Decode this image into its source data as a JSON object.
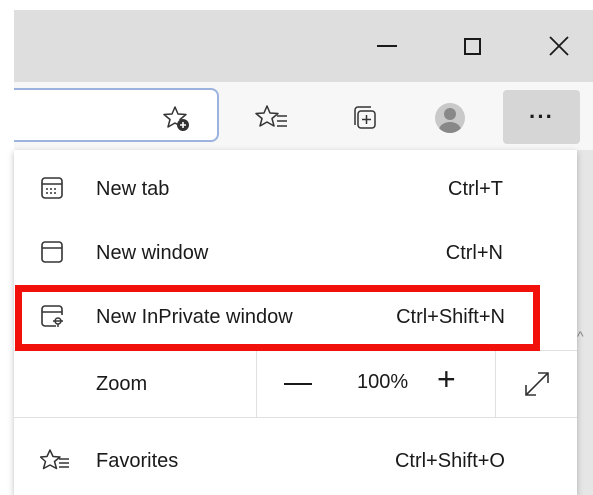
{
  "window": {
    "minimize_icon": "minimize-icon",
    "maximize_icon": "maximize-icon",
    "close_icon": "close-icon"
  },
  "toolbar": {
    "icons": [
      "add-favorite-icon",
      "favorites-icon",
      "collections-icon",
      "profile-avatar",
      "more-icon"
    ],
    "more_label": "···"
  },
  "menu": {
    "items": [
      {
        "label": "New tab",
        "shortcut": "Ctrl+T",
        "icon": "new-tab-icon"
      },
      {
        "label": "New window",
        "shortcut": "Ctrl+N",
        "icon": "new-window-icon"
      },
      {
        "label": "New InPrivate window",
        "shortcut": "Ctrl+Shift+N",
        "icon": "inprivate-icon"
      }
    ],
    "zoom": {
      "label": "Zoom",
      "value": "100%",
      "minus": "—",
      "plus": "+"
    },
    "favorites": {
      "label": "Favorites",
      "shortcut": "Ctrl+Shift+O",
      "icon": "favorites-icon"
    }
  },
  "colors": {
    "highlight": "#f2100a",
    "titlebar": "#dedede",
    "toolbar": "#f7f7f7",
    "more_button": "#d6d6d6"
  }
}
